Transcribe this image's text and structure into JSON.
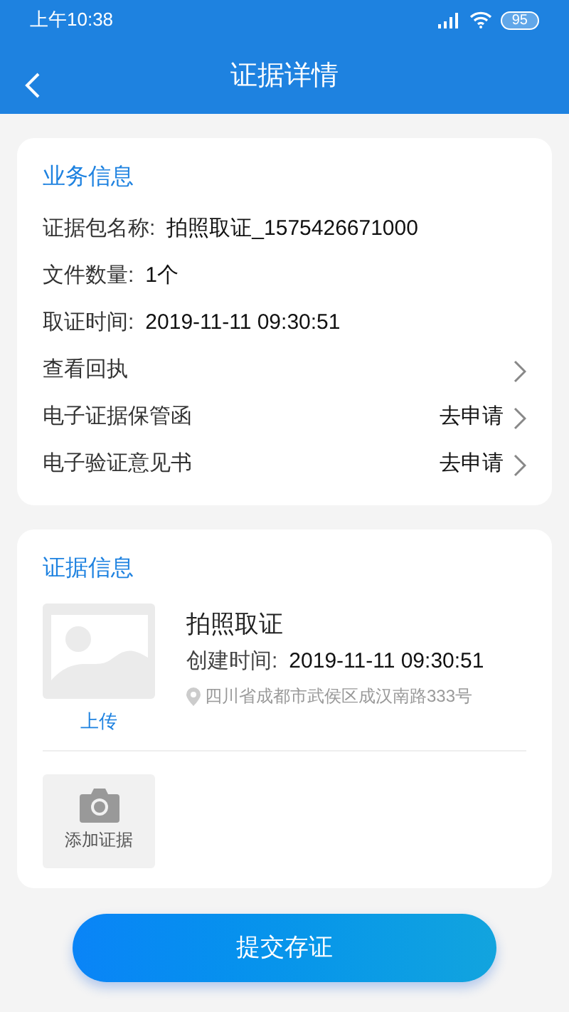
{
  "status_bar": {
    "time": "上午10:38",
    "battery": "95"
  },
  "nav": {
    "title": "证据详情"
  },
  "business": {
    "title": "业务信息",
    "rows": [
      {
        "kind": "field",
        "label": "证据包名称:",
        "value": "拍照取证_1575426671000"
      },
      {
        "kind": "field",
        "label": "文件数量:",
        "value": "1个"
      },
      {
        "kind": "field",
        "label": "取证时间:",
        "value": "2019-11-11 09:30:51"
      },
      {
        "kind": "link",
        "label": "查看回执"
      },
      {
        "kind": "link",
        "label": "电子证据保管函",
        "action": "去申请"
      },
      {
        "kind": "link",
        "label": "电子验证意见书",
        "action": "去申请"
      }
    ]
  },
  "evidence": {
    "title": "证据信息",
    "items": [
      {
        "kind": "picture",
        "upload": "上传",
        "name": "拍照取证",
        "created_label": "创建时间:",
        "created": "2019-11-11 09:30:51",
        "location": "四川省成都市武侯区成汉南路333号"
      }
    ],
    "add": "添加证据"
  },
  "submit": "提交存证"
}
